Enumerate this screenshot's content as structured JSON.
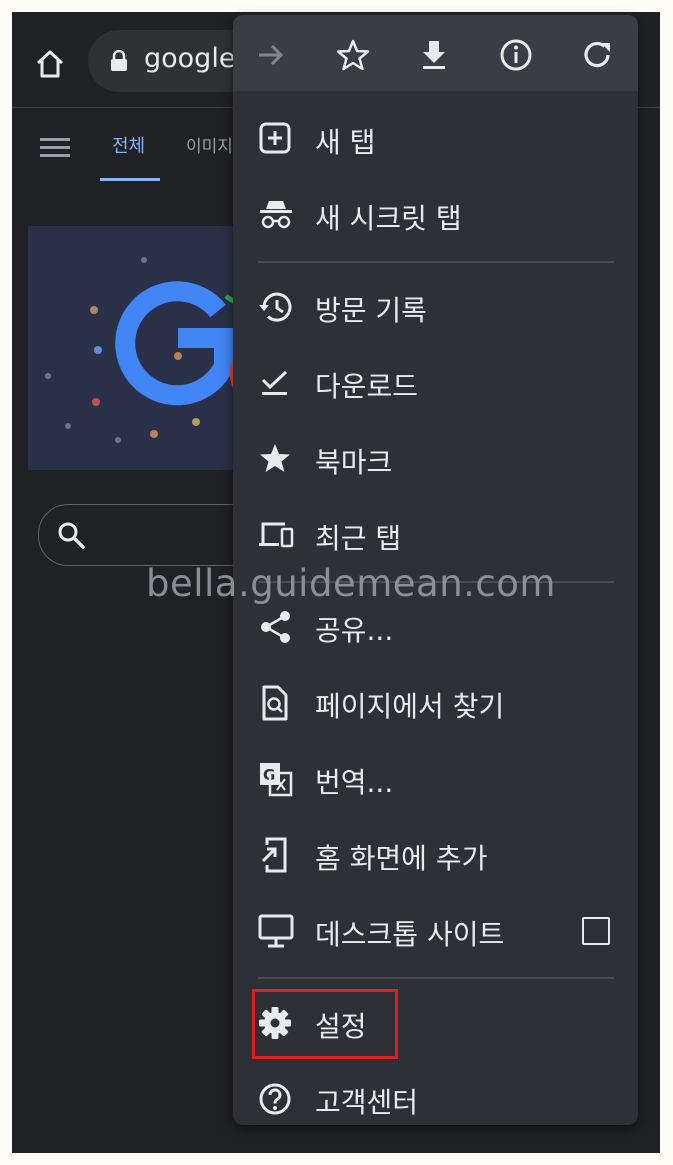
{
  "toolbar": {
    "url": "google.",
    "home_icon": "home-icon",
    "lock_icon": "lock-icon"
  },
  "search_tabs": {
    "all": "전체",
    "images": "이미지"
  },
  "menu": {
    "icon_row": [
      "forward-icon",
      "bookmark-star-icon",
      "download-icon",
      "info-icon",
      "refresh-icon"
    ],
    "items": [
      {
        "label": "새 탭",
        "icon": "new-tab-icon"
      },
      {
        "label": "새 시크릿 탭",
        "icon": "incognito-icon"
      },
      {
        "label": "방문 기록",
        "icon": "history-icon"
      },
      {
        "label": "다운로드",
        "icon": "downloads-icon"
      },
      {
        "label": "북마크",
        "icon": "bookmarks-icon"
      },
      {
        "label": "최근 탭",
        "icon": "recent-tabs-icon"
      },
      {
        "label": "공유...",
        "icon": "share-icon"
      },
      {
        "label": "페이지에서 찾기",
        "icon": "find-in-page-icon"
      },
      {
        "label": "번역...",
        "icon": "translate-icon"
      },
      {
        "label": "홈 화면에 추가",
        "icon": "add-to-home-icon"
      },
      {
        "label": "데스크톱 사이트",
        "icon": "desktop-icon",
        "checked": false
      },
      {
        "label": "설정",
        "icon": "settings-icon",
        "highlighted": true
      },
      {
        "label": "고객센터",
        "icon": "help-icon"
      }
    ]
  },
  "watermark": "bella.guidemean.com",
  "colors": {
    "background": "#202124",
    "menu_bg": "#2e3038",
    "accent": "#8ab4f8",
    "highlight": "#e02020",
    "text": "#e8eaed"
  }
}
